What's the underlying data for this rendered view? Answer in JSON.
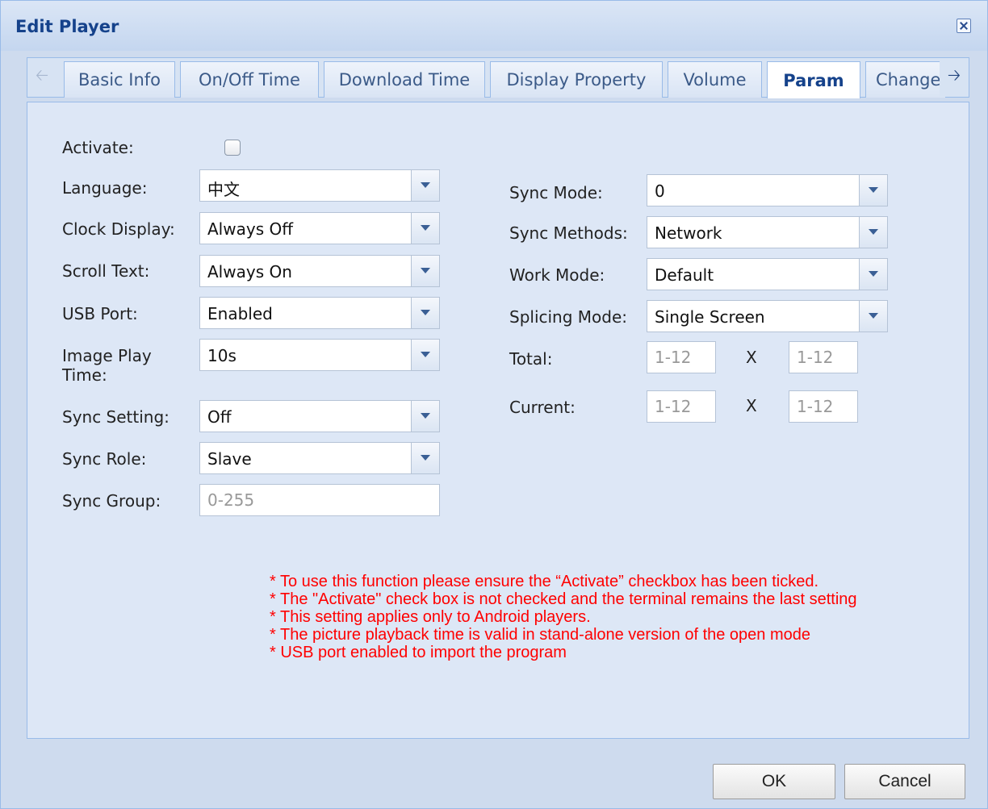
{
  "dialog": {
    "title": "Edit Player"
  },
  "tabs": [
    {
      "label": "Basic Info"
    },
    {
      "label": "On/Off Time"
    },
    {
      "label": "Download Time"
    },
    {
      "label": "Display Property"
    },
    {
      "label": "Volume"
    },
    {
      "label": "Param"
    },
    {
      "label": "Change"
    }
  ],
  "active_tab": "Param",
  "form_left": {
    "activate": {
      "label": "Activate:",
      "checked": false
    },
    "language": {
      "label": "Language:",
      "value": "中文"
    },
    "clock_display": {
      "label": "Clock Display:",
      "value": "Always Off"
    },
    "scroll_text": {
      "label": "Scroll Text:",
      "value": "Always On"
    },
    "usb_port": {
      "label": "USB Port:",
      "value": "Enabled"
    },
    "image_play_time": {
      "label_line1": "Image Play",
      "label_line2": "Time:",
      "value": "10s"
    },
    "sync_setting": {
      "label": "Sync Setting:",
      "value": "Off"
    },
    "sync_role": {
      "label": "Sync Role:",
      "value": "Slave"
    },
    "sync_group": {
      "label": "Sync Group:",
      "placeholder": "0-255"
    }
  },
  "form_right": {
    "sync_mode": {
      "label": "Sync Mode:",
      "value": "0"
    },
    "sync_methods": {
      "label": "Sync Methods:",
      "value": "Network"
    },
    "work_mode": {
      "label": "Work Mode:",
      "value": "Default"
    },
    "splicing_mode": {
      "label": "Splicing Mode:",
      "value": "Single Screen"
    },
    "total": {
      "label": "Total:",
      "placeholder_a": "1-12",
      "separator": "X",
      "placeholder_b": "1-12"
    },
    "current": {
      "label": "Current:",
      "placeholder_a": "1-12",
      "separator": "X",
      "placeholder_b": "1-12"
    }
  },
  "notes": [
    "* To use this function please ensure the “Activate” checkbox has been ticked.",
    "* The \"Activate\" check box is not checked and the terminal remains the last setting",
    "* This setting applies only to Android players.",
    "* The picture playback time is valid in stand-alone version of the open mode",
    "* USB port enabled to import the program"
  ],
  "buttons": {
    "ok": "OK",
    "cancel": "Cancel"
  },
  "colors": {
    "title": "#15428b",
    "note": "#ff0000",
    "panel": "#dde7f6"
  }
}
